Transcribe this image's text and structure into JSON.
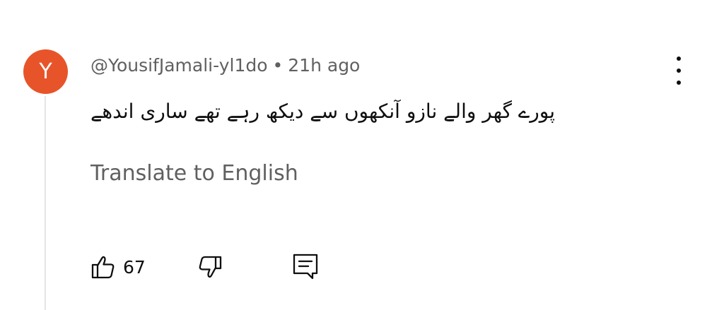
{
  "comment": {
    "avatar_initial": "Y",
    "avatar_color": "#e8542a",
    "author": "@YousifJamali-yl1do",
    "separator": "•",
    "timestamp": "21h ago",
    "text": "پورے گھر والے نازو آنکھوں سے دیکھ رہے تھے ساری اندھے",
    "translate_label": "Translate to English",
    "like_count": "67"
  },
  "icons": {
    "menu": "more-vertical-icon",
    "like": "thumbs-up-icon",
    "dislike": "thumbs-down-icon",
    "reply": "comment-reply-icon"
  },
  "colors": {
    "secondary_text": "#606060",
    "primary_text": "#0f0f0f"
  }
}
